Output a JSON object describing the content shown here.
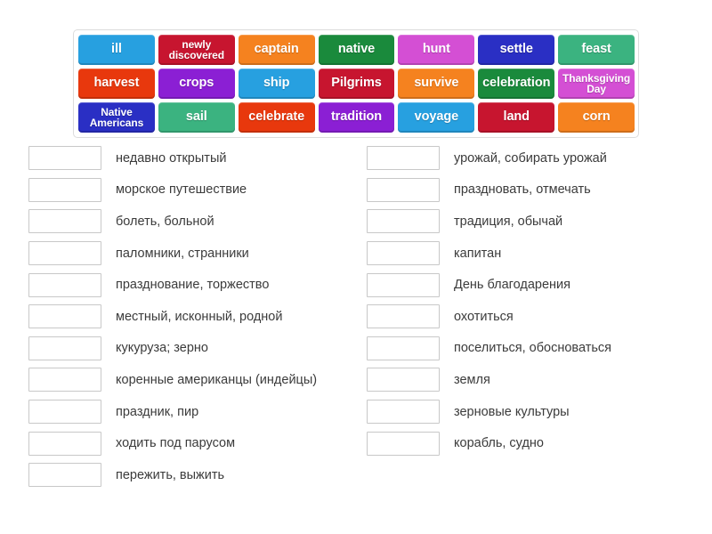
{
  "word_bank": {
    "rows": [
      [
        {
          "label": "ill",
          "color": "#27a0e0",
          "two_line": false
        },
        {
          "label": "newly discovered",
          "color": "#c7152f",
          "two_line": true
        },
        {
          "label": "captain",
          "color": "#f5821f",
          "two_line": false
        },
        {
          "label": "native",
          "color": "#1a8a3c",
          "two_line": false
        },
        {
          "label": "hunt",
          "color": "#d44fd4",
          "two_line": false
        },
        {
          "label": "settle",
          "color": "#2a2fc4",
          "two_line": false
        },
        {
          "label": "feast",
          "color": "#3bb380",
          "two_line": false
        }
      ],
      [
        {
          "label": "harvest",
          "color": "#e8380d",
          "two_line": false
        },
        {
          "label": "crops",
          "color": "#8b1fd4",
          "two_line": false
        },
        {
          "label": "ship",
          "color": "#27a0e0",
          "two_line": false
        },
        {
          "label": "Pilgrims",
          "color": "#c7152f",
          "two_line": false
        },
        {
          "label": "survive",
          "color": "#f5821f",
          "two_line": false
        },
        {
          "label": "celebration",
          "color": "#1a8a3c",
          "two_line": false
        },
        {
          "label": "Thanksgiving Day",
          "color": "#d44fd4",
          "two_line": true
        }
      ],
      [
        {
          "label": "Native Americans",
          "color": "#2a2fc4",
          "two_line": true
        },
        {
          "label": "sail",
          "color": "#3bb380",
          "two_line": false
        },
        {
          "label": "celebrate",
          "color": "#e8380d",
          "two_line": false
        },
        {
          "label": "tradition",
          "color": "#8b1fd4",
          "two_line": false
        },
        {
          "label": "voyage",
          "color": "#27a0e0",
          "two_line": false
        },
        {
          "label": "land",
          "color": "#c7152f",
          "two_line": false
        },
        {
          "label": "corn",
          "color": "#f5821f",
          "two_line": false
        }
      ]
    ]
  },
  "answers": {
    "left_column": [
      {
        "value": "",
        "label": "недавно открытый"
      },
      {
        "value": "",
        "label": "морское путешествие"
      },
      {
        "value": "",
        "label": "болеть, больной"
      },
      {
        "value": "",
        "label": "паломники, странники"
      },
      {
        "value": "",
        "label": "празднование, торжество"
      },
      {
        "value": "",
        "label": "местный, исконный, родной"
      },
      {
        "value": "",
        "label": "кукуруза; зерно"
      },
      {
        "value": "",
        "label": "коренные американцы (индейцы)"
      },
      {
        "value": "",
        "label": "праздник, пир"
      },
      {
        "value": "",
        "label": "ходить под парусом"
      },
      {
        "value": "",
        "label": "пережить, выжить"
      }
    ],
    "right_column": [
      {
        "value": "",
        "label": "урожай, собирать урожай"
      },
      {
        "value": "",
        "label": "праздновать, отмечать"
      },
      {
        "value": "",
        "label": "традиция, обычай"
      },
      {
        "value": "",
        "label": "капитан"
      },
      {
        "value": "",
        "label": "День благодарения"
      },
      {
        "value": "",
        "label": "охотиться"
      },
      {
        "value": "",
        "label": "поселиться, обосноваться"
      },
      {
        "value": "",
        "label": "земля"
      },
      {
        "value": "",
        "label": "зерновые культуры"
      },
      {
        "value": "",
        "label": "корабль, судно"
      }
    ]
  }
}
